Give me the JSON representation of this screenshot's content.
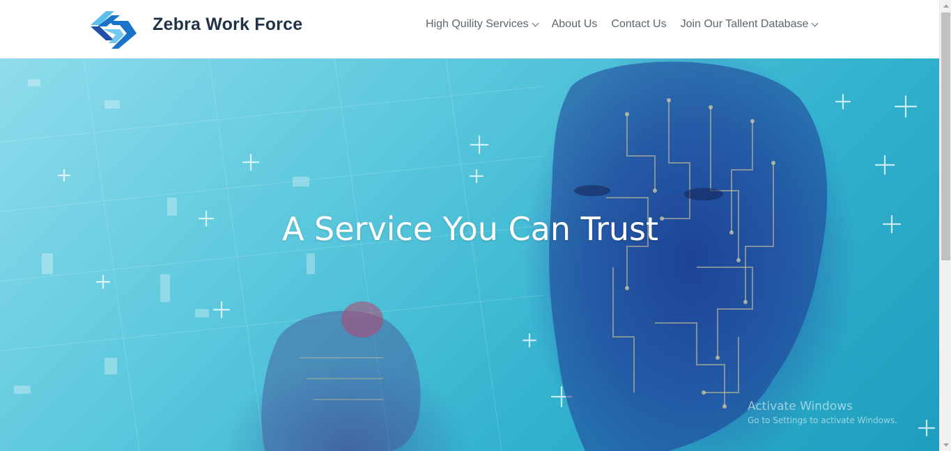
{
  "brand": {
    "name": "Zebra Work Force",
    "logo_icon": "chevron-arrows-logo-icon",
    "logo_colors": [
      "#1a73c9",
      "#5cc0ef",
      "#1f4fa8"
    ]
  },
  "nav": {
    "items": [
      {
        "label": "High Quility Services",
        "has_dropdown": true
      },
      {
        "label": "About Us",
        "has_dropdown": false
      },
      {
        "label": "Contact Us",
        "has_dropdown": false
      },
      {
        "label": "Join Our Tallent Database",
        "has_dropdown": true
      }
    ]
  },
  "hero": {
    "title": "A Service You Can Trust",
    "image": "ai-circuit-face-background"
  },
  "watermark": {
    "title": "Activate Windows",
    "subtitle": "Go to Settings to activate Windows."
  },
  "colors": {
    "brand_text": "#1f3347",
    "nav_text": "#5b6670",
    "hero_accent": "#34b3cf"
  }
}
